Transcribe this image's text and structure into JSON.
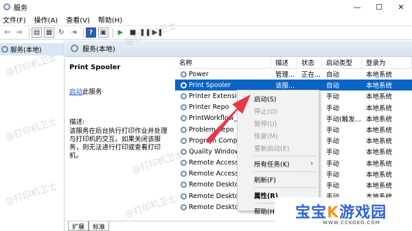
{
  "window": {
    "title": "服务",
    "min": "—",
    "max": "☐",
    "close": "✕"
  },
  "menu": [
    "文件(F)",
    "操作(A)",
    "查看(V)",
    "帮助(H)"
  ],
  "tree": {
    "root": "服务(本地)"
  },
  "main": {
    "header": "服务(本地)",
    "selected_service": "Print Spooler",
    "start_link": "启动",
    "start_suffix": "此服务",
    "desc_label": "描述:",
    "desc_text": "该服务在后台执行打印作业并处理与打印机的交互。如果关闭该服务，则无法进行打印或查看打印机。"
  },
  "columns": [
    "名称",
    "描述",
    "状态",
    "启动类型",
    "登录为"
  ],
  "rows": [
    {
      "name": "Power",
      "desc": "管理...",
      "status": "正在...",
      "type": "自动",
      "logon": "本地系统"
    },
    {
      "name": "Print Spooler",
      "desc": "该服...",
      "status": "",
      "type": "自动",
      "logon": "本地系统",
      "selected": true
    },
    {
      "name": "Printer Extensio",
      "desc": "",
      "status": "",
      "type": "手动",
      "logon": "本地系统"
    },
    {
      "name": "Printer Repo",
      "desc": "",
      "status": "",
      "type": "手动",
      "logon": "本地系统"
    },
    {
      "name": "PrintWorkflow_",
      "desc": "",
      "status": "",
      "type": "手动(触发...",
      "logon": "本地系统"
    },
    {
      "name": "Problem Repo",
      "desc": "",
      "status": "",
      "type": "手动",
      "logon": "本地系统"
    },
    {
      "name": "Program Comp",
      "desc": "",
      "status": "",
      "type": "手动",
      "logon": "本地系统"
    },
    {
      "name": "Quality Window",
      "desc": "",
      "status": "",
      "type": "手动",
      "logon": "本地系统"
    },
    {
      "name": "Remote Access",
      "desc": "",
      "status": "",
      "type": "手动",
      "logon": "本地系统"
    },
    {
      "name": "Remote Access",
      "desc": "",
      "status": "",
      "type": "手动",
      "logon": "本地系统"
    },
    {
      "name": "Remote Deskto",
      "desc": "",
      "status": "",
      "type": "手动",
      "logon": "本地系统"
    },
    {
      "name": "Remote Deskto",
      "desc": "",
      "status": "",
      "type": "手动",
      "logon": "本地系统"
    },
    {
      "name": "Remote Deskto",
      "desc": "",
      "status": "",
      "type": "手动",
      "logon": "本地系统"
    }
  ],
  "tabs": [
    "扩展",
    "标准"
  ],
  "context_menu": {
    "start": "启动(S)",
    "stop": "停止(O)",
    "pause": "暂停(U)",
    "resume": "恢复(M)",
    "restart": "重新启动(E)",
    "all_tasks": "所有任务(K)",
    "refresh": "刷新(F)",
    "properties": "属性(R)",
    "help": "帮助(H)"
  },
  "watermark": "@打印机卫士",
  "logo": {
    "title": "宝宝",
    "title2": "游戏园",
    "url": "WWW.CCKOKO.COM"
  },
  "colors": {
    "selection": "#0a64c4",
    "arrow": "#e8364a",
    "logo": "#2c63d8"
  }
}
